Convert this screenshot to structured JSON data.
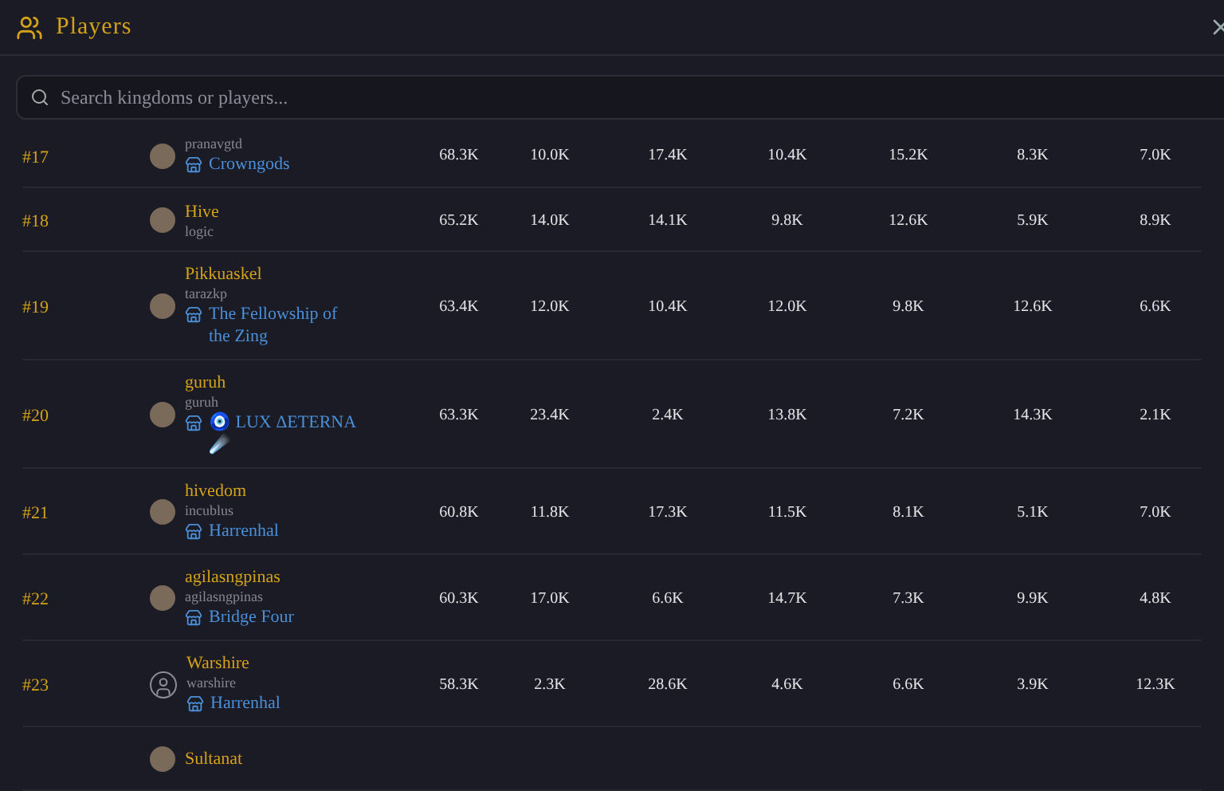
{
  "window": {
    "title": "Players"
  },
  "search": {
    "placeholder": "Search kingdoms or players..."
  },
  "rows": [
    {
      "rank": "#17",
      "kind": "photo",
      "account": "pranavgtd",
      "guild": "Crowngods",
      "values": [
        "68.3K",
        "10.0K",
        "17.4K",
        "10.4K",
        "15.2K",
        "8.3K",
        "7.0K"
      ]
    },
    {
      "rank": "#18",
      "kind": "photo",
      "name": "Hive",
      "account": "logic",
      "values": [
        "65.2K",
        "14.0K",
        "14.1K",
        "9.8K",
        "12.6K",
        "5.9K",
        "8.9K"
      ]
    },
    {
      "rank": "#19",
      "kind": "photo",
      "name": "Pikkuaskel",
      "account": "tarazkp",
      "guild": "The Fellowship of the Zing",
      "values": [
        "63.4K",
        "12.0K",
        "10.4K",
        "12.0K",
        "9.8K",
        "12.6K",
        "6.6K"
      ]
    },
    {
      "rank": "#20",
      "kind": "photo",
      "name": "guruh",
      "account": "guruh",
      "guild": "🧿 LUX ΔETERNA ☄️",
      "values": [
        "63.3K",
        "23.4K",
        "2.4K",
        "13.8K",
        "7.2K",
        "14.3K",
        "2.1K"
      ]
    },
    {
      "rank": "#21",
      "kind": "photo",
      "name": "hivedom",
      "account": "incublus",
      "guild": "Harrenhal",
      "values": [
        "60.8K",
        "11.8K",
        "17.3K",
        "11.5K",
        "8.1K",
        "5.1K",
        "7.0K"
      ]
    },
    {
      "rank": "#22",
      "kind": "photo",
      "name": "agilasngpinas",
      "account": "agilasngpinas",
      "guild": "Bridge Four",
      "values": [
        "60.3K",
        "17.0K",
        "6.6K",
        "14.7K",
        "7.3K",
        "9.9K",
        "4.8K"
      ]
    },
    {
      "rank": "#23",
      "kind": "silhouette",
      "name": "Warshire",
      "account": "warshire",
      "guild": "Harrenhal",
      "values": [
        "58.3K",
        "2.3K",
        "28.6K",
        "4.6K",
        "6.6K",
        "3.9K",
        "12.3K"
      ]
    },
    {
      "kind": "photo",
      "name": "Sultanat"
    }
  ]
}
